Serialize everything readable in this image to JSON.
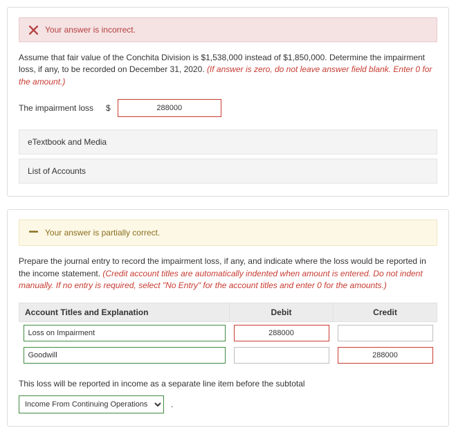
{
  "panel1": {
    "alert_text": "Your answer is incorrect.",
    "question_plain": "Assume that fair value of the Conchita Division is $1,538,000 instead of $1,850,000. Determine the impairment loss, if any, to be recorded on December 31, 2020. ",
    "question_red": "(If answer is zero, do not leave answer field blank. Enter 0 for the amount.)",
    "label_impairment": "The impairment loss",
    "dollar": "$",
    "impairment_value": "288000",
    "bar_etextbook": "eTextbook and Media",
    "bar_accounts": "List of Accounts"
  },
  "panel2": {
    "alert_text": "Your answer is partially correct.",
    "question_plain": "Prepare the journal entry to record the impairment loss, if any, and indicate where the loss would be reported in the income statement. ",
    "question_red": "(Credit account titles are automatically indented when amount is entered. Do not indent manually. If no entry is required, select \"No Entry\" for the account titles and enter 0 for the amounts.)",
    "th_account": "Account Titles and Explanation",
    "th_debit": "Debit",
    "th_credit": "Credit",
    "rows": [
      {
        "account": "Loss on Impairment",
        "debit": "288000",
        "credit": ""
      },
      {
        "account": "Goodwill",
        "debit": "",
        "credit": "288000"
      }
    ],
    "footer_text": "This loss will be reported in income as a separate line item before the subtotal",
    "select_value": "Income From Continuing Operations",
    "period": "."
  }
}
